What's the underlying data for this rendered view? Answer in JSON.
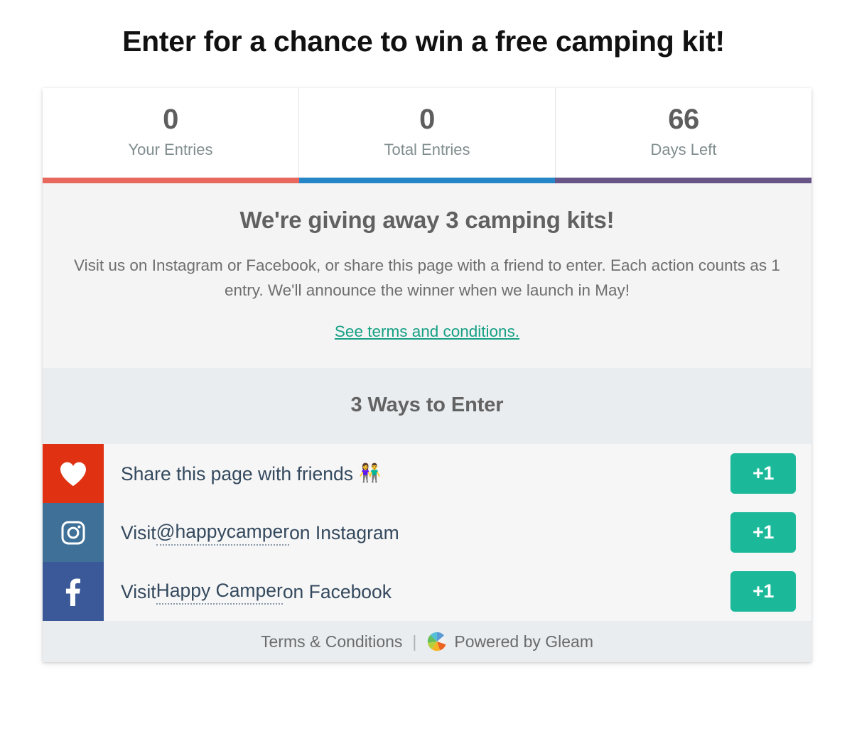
{
  "page": {
    "heading": "Enter for a chance to win a free camping kit!"
  },
  "stats": {
    "items": [
      {
        "value": "0",
        "label": "Your Entries",
        "bar_color": "#e8685e"
      },
      {
        "value": "0",
        "label": "Total Entries",
        "bar_color": "#2486c6"
      },
      {
        "value": "66",
        "label": "Days Left",
        "bar_color": "#675588"
      }
    ]
  },
  "description": {
    "title": "We're giving away 3 camping kits!",
    "body": "Visit us on Instagram or Facebook, or share this page with a friend to enter. Each action counts as 1 entry. We'll announce the winner when we launch in May!",
    "link_label": "See terms and conditions."
  },
  "ways": {
    "header": "3 Ways to Enter",
    "entries": [
      {
        "icon": "heart-icon",
        "icon_bg": "#e03212",
        "label_prefix": "Share this page with friends",
        "label_link": "",
        "label_suffix": "",
        "emoji": "👫",
        "action_label": "+1"
      },
      {
        "icon": "instagram-icon",
        "icon_bg": "#3e7098",
        "label_prefix": "Visit ",
        "label_link": "@happycamper",
        "label_suffix": " on Instagram",
        "emoji": "",
        "action_label": "+1"
      },
      {
        "icon": "facebook-icon",
        "icon_bg": "#3b5998",
        "label_prefix": "Visit ",
        "label_link": "Happy Camper",
        "label_suffix": " on Facebook",
        "emoji": "",
        "action_label": "+1"
      }
    ]
  },
  "footer": {
    "terms_label": "Terms & Conditions",
    "separator": "|",
    "powered_label": "Powered by Gleam"
  },
  "colors": {
    "accent_green": "#1bb99a",
    "link_green": "#16a085",
    "entry_text": "#34495e",
    "stat_label": "#7f8c8d",
    "description_bg": "#f4f4f4",
    "ways_bg": "#e9edf0",
    "entries_bg": "#f6f6f6"
  }
}
